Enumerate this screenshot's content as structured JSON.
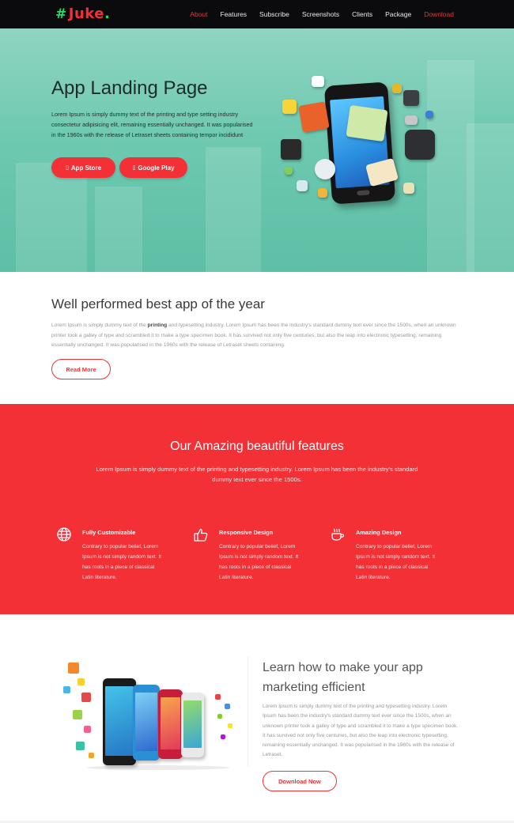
{
  "nav": {
    "logo_text": "Juke",
    "items": [
      "About",
      "Features",
      "Subscribe",
      "Screenshots",
      "Clients",
      "Package",
      "Download"
    ]
  },
  "hero": {
    "title": "App Landing Page",
    "description": "Lorem Ipsum is simply dummy text of the printing and type setting industry consectetur adipisicing elit, remaining essentially unchanged. It was popularised in the 1960s with the release of Letraset sheets containing tempor incididunt",
    "app_store_label": "App Store",
    "google_play_label": "Google Play"
  },
  "intro": {
    "title": "Well performed best app of the year",
    "desc_before": "Lorem Ipsum is simply dummy text of the ",
    "desc_bold": "printing",
    "desc_after": " and typesetting industry. Lorem Ipsum has been the industry's standard dummy text ever since the 1500s, when an unknown printer took a galley of type and scrambled it to make a type specimen book. It has survived not only five centuries, but also the leap into electronic typesetting, remaining essentially unchanged. It was popularised in the 1960s with the release of Letraset sheets containing.",
    "read_more_label": "Read More"
  },
  "features": {
    "title": "Our Amazing beautiful features",
    "subtitle": "Lorem Ipsum is simply dummy text of the printing and typesetting industry. Lorem Ipsum has been the industry's standard dummy text ever since the 1500s.",
    "items": [
      {
        "icon": "globe-icon",
        "name": "Fully Customizable",
        "desc": "Contrary to popular belief, Lorem Ipsum is not simply random text. It has roots in a piece of classical Latin literature."
      },
      {
        "icon": "thumbs-up-icon",
        "name": "Responsive Design",
        "desc": "Contrary to popular belief, Lorem Ipsum is not simply random text. It has roots in a piece of classical Latin literature."
      },
      {
        "icon": "coffee-cup-icon",
        "name": "Amazing Design",
        "desc": "Contrary to popular belief, Lorem Ipsum is not simply random text. It has roots in a piece of classical Latin literature."
      }
    ]
  },
  "marketing": {
    "title": "Learn how to make your app marketing efficient",
    "description": "Lorem Ipsum is simply dummy text of the printing and typesetting industry. Lorem Ipsum has been the industry's standard dummy text ever since the 1500s, when an unknown printer took a galley of type and scrambled it to make a type specimen book. It has survived not only five centuries, but also the leap into electronic typesetting, remaining essentially unchanged. It was popularised in the 1960s with the release of Letraset.",
    "download_label": "Download Now"
  },
  "colors": {
    "brand_red": "#f23036",
    "nav_bg": "#0b0b0d",
    "hero_teal": "#6ec9b0",
    "logo_green": "#2bd36b"
  }
}
